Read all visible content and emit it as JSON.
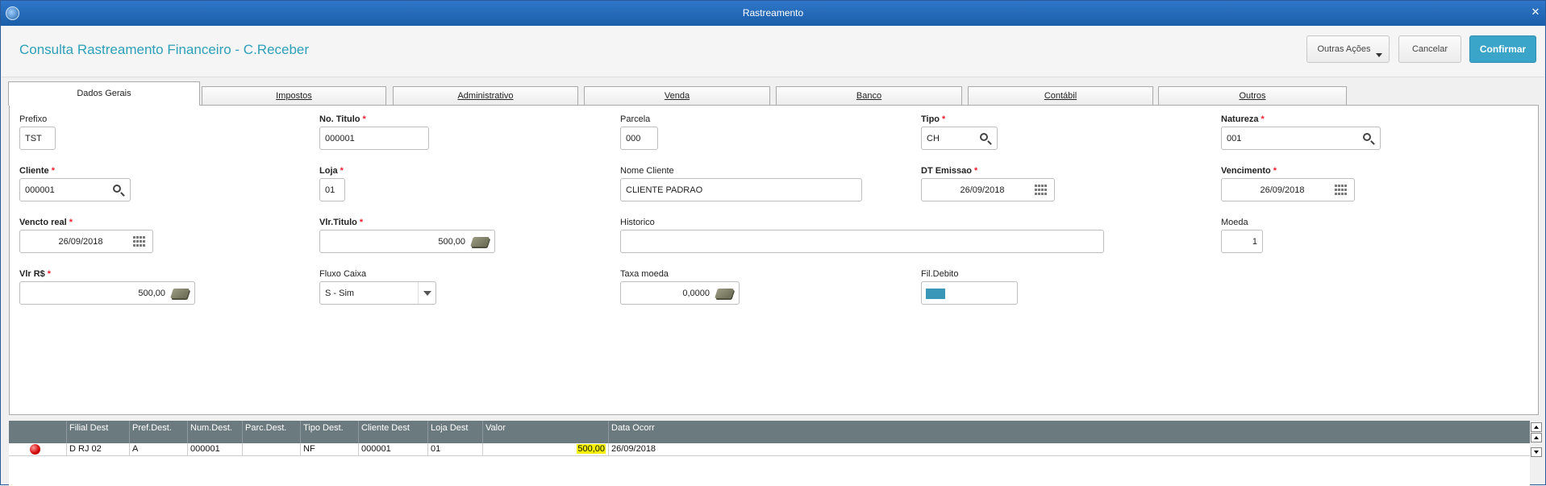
{
  "window": {
    "title": "Rastreamento"
  },
  "header": {
    "title": "Consulta Rastreamento Financeiro - C.Receber",
    "more_actions": "Outras Ações",
    "cancel": "Cancelar",
    "confirm": "Confirmar"
  },
  "tabs": [
    {
      "label": "Dados Gerais"
    },
    {
      "label": "Impostos"
    },
    {
      "label": "Administrativo"
    },
    {
      "label": "Venda"
    },
    {
      "label": "Banco"
    },
    {
      "label": "Contábil"
    },
    {
      "label": "Outros"
    }
  ],
  "form": {
    "prefixo": {
      "label": "Prefixo",
      "value": "TST"
    },
    "no_titulo": {
      "label": "No. Titulo",
      "value": "000001"
    },
    "parcela": {
      "label": "Parcela",
      "value": "000"
    },
    "tipo": {
      "label": "Tipo",
      "value": "CH"
    },
    "natureza": {
      "label": "Natureza",
      "value": "001"
    },
    "cliente": {
      "label": "Cliente",
      "value": "000001"
    },
    "loja": {
      "label": "Loja",
      "value": "01"
    },
    "nome_cliente": {
      "label": "Nome Cliente",
      "value": "CLIENTE PADRAO"
    },
    "dt_emissao": {
      "label": "DT Emissao",
      "value": "26/09/2018"
    },
    "vencimento": {
      "label": "Vencimento",
      "value": "26/09/2018"
    },
    "vencto_real": {
      "label": "Vencto real",
      "value": "26/09/2018"
    },
    "vlr_titulo": {
      "label": "Vlr.Titulo",
      "value": "500,00"
    },
    "historico": {
      "label": "Historico",
      "value": ""
    },
    "moeda": {
      "label": "Moeda",
      "value": "1"
    },
    "vlr_rs": {
      "label": "Vlr R$",
      "value": "500,00"
    },
    "fluxo_caixa": {
      "label": "Fluxo Caixa",
      "value": "S - Sim"
    },
    "taxa_moeda": {
      "label": "Taxa moeda",
      "value": "0,0000"
    },
    "fil_debito": {
      "label": "Fil.Debito",
      "color": "#3b97b9"
    }
  },
  "grid": {
    "columns": [
      "Filial Dest",
      "Pref.Dest.",
      "Num.Dest.",
      "Parc.Dest.",
      "Tipo Dest.",
      "Cliente Dest",
      "Loja Dest",
      "Valor",
      "Data Ocorr"
    ],
    "rows": [
      {
        "status_color": "#d10000",
        "cells": [
          "D RJ 02",
          "A",
          "000001",
          "",
          "NF",
          "000001",
          "01",
          "500,00",
          "26/09/2018"
        ]
      }
    ]
  },
  "colors": {
    "accent": "#3aa4c9",
    "title": "#2e9fb8",
    "required": "#e23",
    "highlight": "#f4f000"
  }
}
